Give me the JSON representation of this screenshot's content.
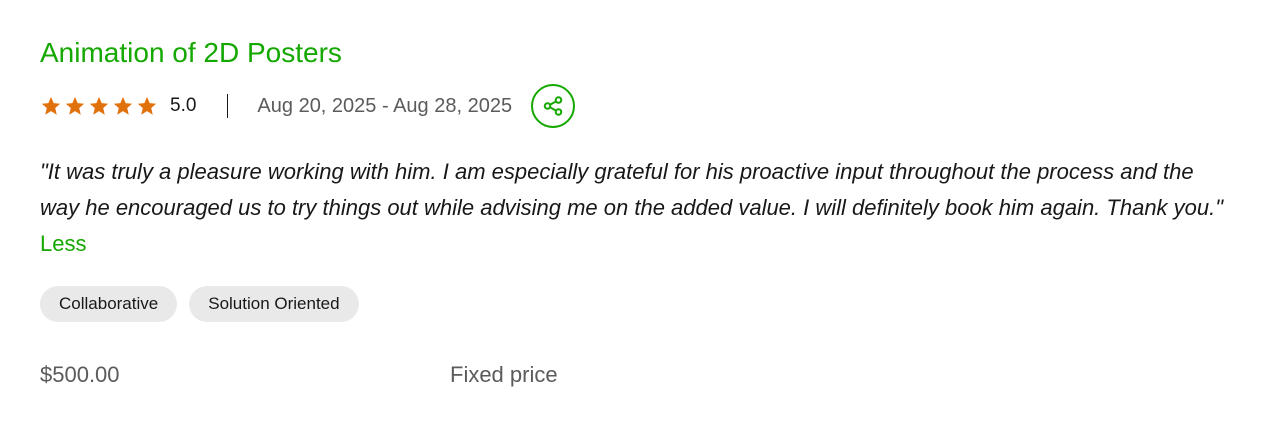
{
  "job": {
    "title": "Animation of 2D Posters",
    "rating": {
      "value": "5.0",
      "stars_filled": 5,
      "stars_total": 5
    },
    "date_range": "Aug 20, 2025 - Aug 28, 2025",
    "share_icon": "share-icon",
    "review": {
      "text": "\"It was truly a pleasure working with him. I am especially grateful for his proactive input throughout the process and the way he encouraged us to try things out while advising me on the added value. I will definitely book him again. Thank you.\"",
      "less_label": "Less"
    },
    "tags": [
      "Collaborative",
      "Solution Oriented"
    ],
    "price": "$500.00",
    "price_type": "Fixed price"
  },
  "colors": {
    "brand_green": "#14a800",
    "star_orange": "#e1720b",
    "muted_text": "#5b5b5b",
    "tag_bg": "#e9e9e9"
  }
}
